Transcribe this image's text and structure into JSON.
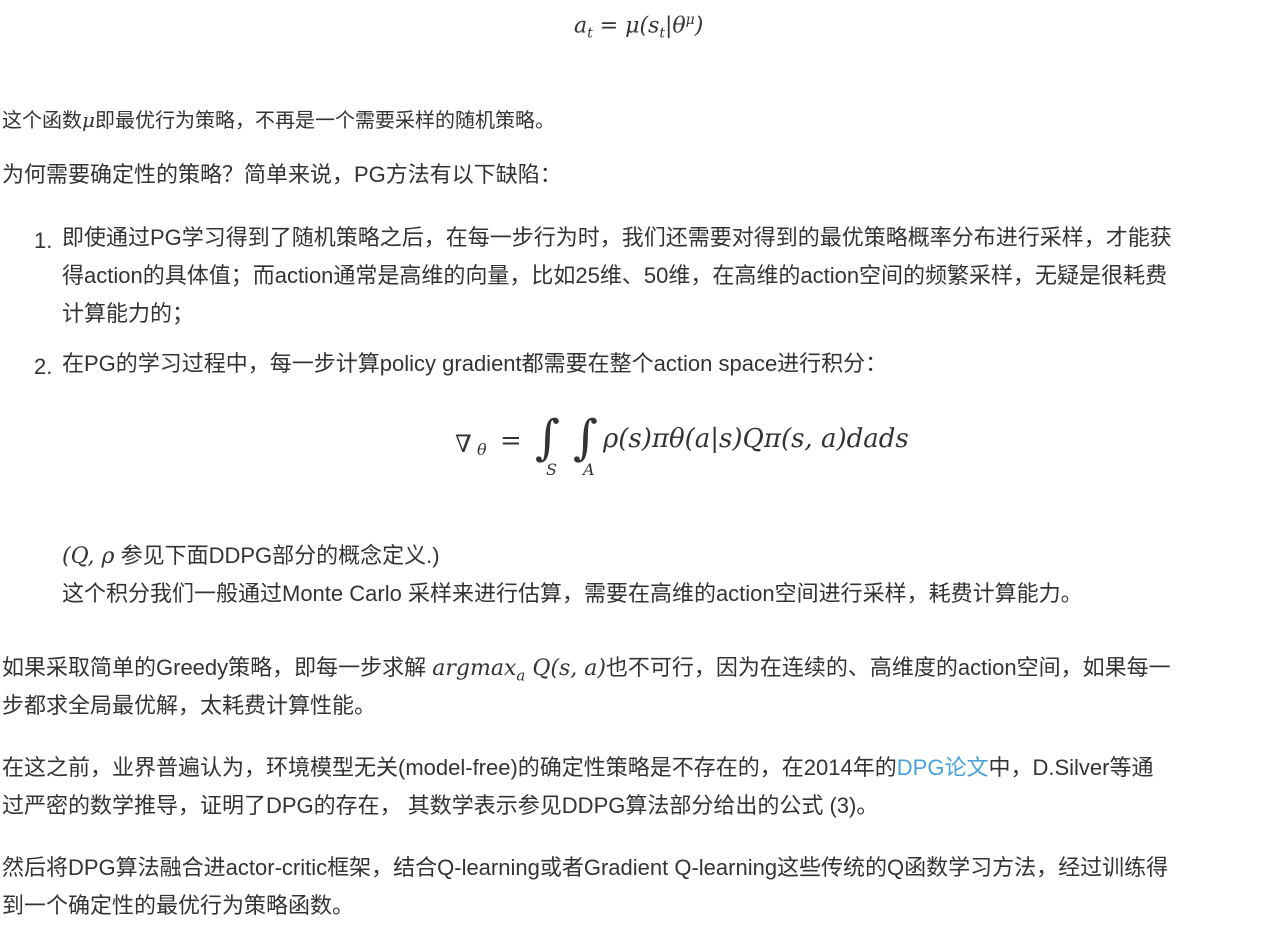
{
  "equation_top": {
    "lhs": "a",
    "lhs_sub": "t",
    "eq": " = μ(s",
    "s_sub": "t",
    "mid": "|θ",
    "theta_sup": "μ",
    "close": ")"
  },
  "para1": {
    "prefix": "这个函数",
    "mu": "μ",
    "suffix": "即最优行为策略，不再是一个需要采样的随机策略。"
  },
  "para2": "为何需要确定性的策略？简单来说，PG方法有以下缺陷：",
  "list": [
    {
      "num": "1.",
      "lines": [
        "即使通过PG学习得到了随机策略之后，在每一步行为时，我们还需要对得到的最优策略概率分布进行采样，才能获",
        "得action的具体值；而action通常是高维的向量，比如25维、50维，在高维的action空间的频繁采样，无疑是很耗费",
        "计算能力的；"
      ]
    },
    {
      "num": "2.",
      "lines": [
        "在PG的学习过程中，每一步计算policy gradient都需要在整个action space进行积分："
      ]
    }
  ],
  "equation_integral": {
    "nabla": "∇",
    "theta": "θ",
    "eq": "=",
    "int": "∫",
    "sub_s": "S",
    "sub_a": "A",
    "body": "ρ(s)πθ(a|s)Qπ(s, a)dads"
  },
  "note_line1": {
    "math": "(Q, ρ",
    "text": " 参见下面DDPG部分的概念定义.)"
  },
  "note_line2": "这个积分我们一般通过Monte Carlo 采样来进行估算，需要在高维的action空间进行采样，耗费计算能力。",
  "para3": {
    "prefix": "如果采取简单的Greedy策略，即每一步求解 ",
    "math_main": "argmax",
    "math_sub": "a",
    "math_rest": " Q(s, a)",
    "suffix": "也不可行，因为在连续的、高维度的action空间，如果每一",
    "line2": "步都求全局最优解，太耗费计算性能。"
  },
  "para4": {
    "prefix": "在这之前，业界普遍认为，环境模型无关(model-free)的确定性策略是不存在的，在2014年的",
    "link": "DPG论文",
    "suffix": "中，D.Silver等通",
    "line2": "过严密的数学推导，证明了DPG的存在， 其数学表示参见DDPG算法部分给出的公式 (3)。"
  },
  "para5": {
    "line1": "然后将DPG算法融合进actor-critic框架，结合Q-learning或者Gradient Q-learning这些传统的Q函数学习方法，经过训练得",
    "line2": "到一个确定性的最优行为策略函数。"
  },
  "colors": {
    "text": "#333333",
    "link": "#4aa3d8",
    "background": "#ffffff"
  }
}
